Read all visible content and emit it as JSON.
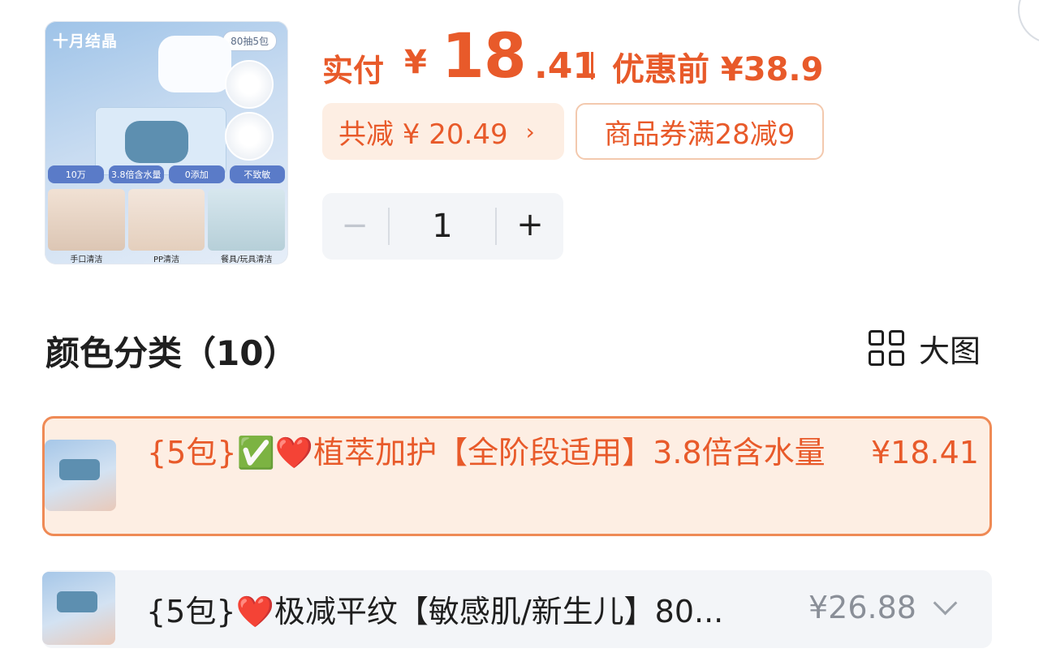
{
  "product": {
    "image": {
      "brand": "十月结晶",
      "spec_badge": "80抽5包",
      "tags": [
        "10万",
        "3.8倍含水量",
        "0添加",
        "不致敏"
      ],
      "captions": [
        "手口清洁",
        "PP清洁",
        "餐具/玩具清洁"
      ]
    },
    "pay_label": "实付",
    "currency": "¥",
    "price_int": "18",
    "price_dec": ".41",
    "original_price": "优惠前 ¥38.9",
    "discount_text": "共减 ¥ 20.49",
    "discount_chevron": "›",
    "coupon_text": "商品券满28减9",
    "quantity": "1",
    "minus": "−",
    "plus": "+"
  },
  "section": {
    "title": "颜色分类（10）",
    "big_view_label": "大图"
  },
  "skus": [
    {
      "name": "{5包}✅❤️植萃加护【全阶段适用】3.8倍含水量",
      "price": "¥18.41",
      "selected": true
    },
    {
      "name": "{5包}❤️极减平纹【敏感肌/新生儿】80...",
      "price": "¥26.88",
      "selected": false
    }
  ],
  "colors": {
    "accent": "#e85a2a",
    "accent_bg": "#fdeee3",
    "neutral_bg": "#f3f5f8"
  }
}
